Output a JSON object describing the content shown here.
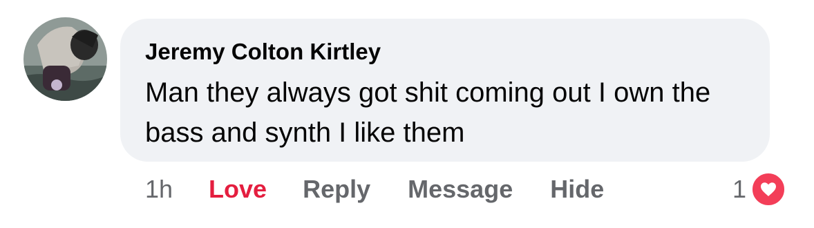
{
  "comment": {
    "author": "Jeremy Colton Kirtley",
    "text": "Man they always got shit coming out I own the bass and synth I like them",
    "timestamp": "1h",
    "actions": {
      "love": "Love",
      "reply": "Reply",
      "message": "Message",
      "hide": "Hide"
    },
    "reactions": {
      "count": "1",
      "type_icon": "heart-icon"
    }
  },
  "colors": {
    "bubble_bg": "#f0f2f5",
    "love_active": "#e41e3f",
    "meta_gray": "#65676b",
    "heart_badge": "#f33e58"
  }
}
